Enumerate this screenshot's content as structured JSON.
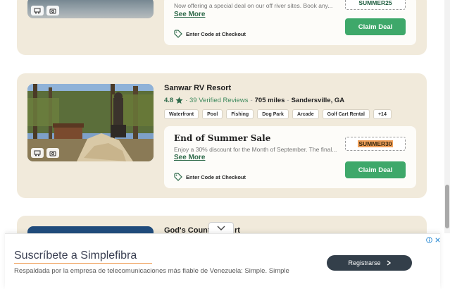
{
  "listings": [
    {
      "photo_icons": [
        "rv-icon",
        "camera-360-icon"
      ],
      "deal": {
        "description": "Now offering a special deal on our off river sites. Book any...",
        "see_more": "See More",
        "enter_code": "Enter Code at Checkout",
        "code": "SUMMER25",
        "claim": "Claim Deal"
      }
    },
    {
      "name": "Sanwar RV Resort",
      "rating": "4.8",
      "reviews": "· 39 Verified Reviews",
      "sep": "-",
      "miles": "705 miles",
      "sep2": "-",
      "location": "Sandersville, GA",
      "amenities": [
        "Waterfront",
        "Pool",
        "Fishing",
        "Dog Park",
        "Arcade",
        "Golf Cart Rental",
        "+14"
      ],
      "photo_icons": [
        "rv-icon",
        "camera-360-icon"
      ],
      "deal": {
        "title": "End of Summer Sale",
        "description": "Enjoy a 30% discount for the Month of September. The final...",
        "see_more": "See More",
        "enter_code": "Enter Code at Checkout",
        "code": "SUMMER30",
        "claim": "Claim Deal"
      }
    },
    {
      "name_partial_left": "God's Count",
      "name_partial_right": "rt"
    }
  ],
  "ad": {
    "title": "Suscríbete a Simplefibra",
    "subtitle": "Respaldada por la empresa de telecomunicaciones más fiable de Venezuela: Simple. Simple",
    "button": "Registrarse"
  },
  "colors": {
    "accent_green": "#3ea86a",
    "dark_green": "#2e6a4a",
    "card_bg": "#f1eadb",
    "code_highlight": "#f0a05a",
    "ad_button": "#333f4a"
  }
}
